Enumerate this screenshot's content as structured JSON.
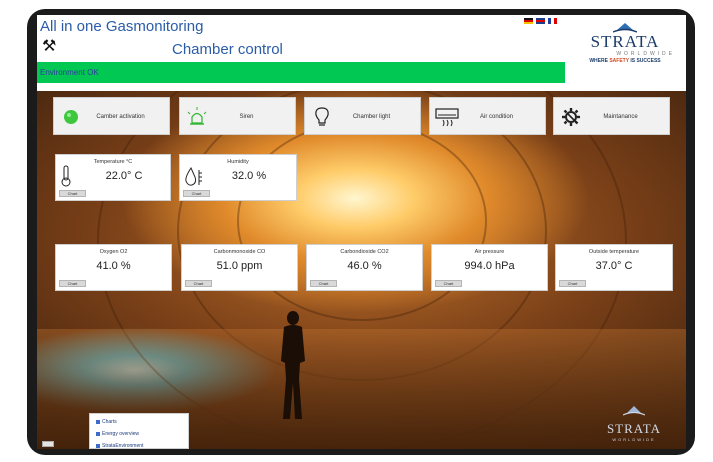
{
  "header": {
    "app_title": "All in one Gasmonitoring",
    "chamber_title": "Chamber control",
    "tools_icon": "hammer-and-pick-icon",
    "languages": [
      "de",
      "uk",
      "fr"
    ]
  },
  "logo": {
    "name": "STRATA",
    "sub": "WORLDWIDE",
    "tagline_pre": "WHERE ",
    "tagline_highlight": "SAFETY",
    "tagline_post": " IS SUCCESS"
  },
  "status": {
    "text": "Environment OK",
    "color": "#00c853"
  },
  "actions": [
    {
      "label": "Camber activation",
      "icon": "green-status-light-icon"
    },
    {
      "label": "Siren",
      "icon": "siren-icon"
    },
    {
      "label": "Chamber light",
      "icon": "light-bulb-icon"
    },
    {
      "label": "Air condition",
      "icon": "air-conditioner-icon"
    },
    {
      "label": "Maintanance",
      "icon": "gear-wrench-icon"
    }
  ],
  "sensors_top": [
    {
      "title": "Temperature °C",
      "value": "22.0° C",
      "chart": "Chart",
      "icon": "thermometer-icon"
    },
    {
      "title": "Humidity",
      "value": "32.0 %",
      "chart": "Chart",
      "icon": "humidity-drop-icon"
    }
  ],
  "sensors_bottom": [
    {
      "title": "Oxygen O2",
      "value": "41.0 %",
      "chart": "Chart"
    },
    {
      "title": "Carbonmonoxide CO",
      "value": "51.0 ppm",
      "chart": "Chart"
    },
    {
      "title": "Carbondioxide CO2",
      "value": "46.0 %",
      "chart": "Chart"
    },
    {
      "title": "Air pressure",
      "value": "994.0 hPa",
      "chart": "Chart"
    },
    {
      "title": "Outside temperature",
      "value": "37.0° C",
      "chart": "Chart"
    }
  ],
  "nav": {
    "items": [
      "Charts",
      "Energy overview",
      "StrataEnvironment"
    ]
  },
  "watermark": {
    "name": "STRATA",
    "sub": "WORLDWIDE"
  },
  "colors": {
    "title_blue": "#2a5ca8",
    "status_green": "#00c853",
    "brand_navy": "#1b3c6a",
    "brand_orange": "#d24a1c"
  }
}
